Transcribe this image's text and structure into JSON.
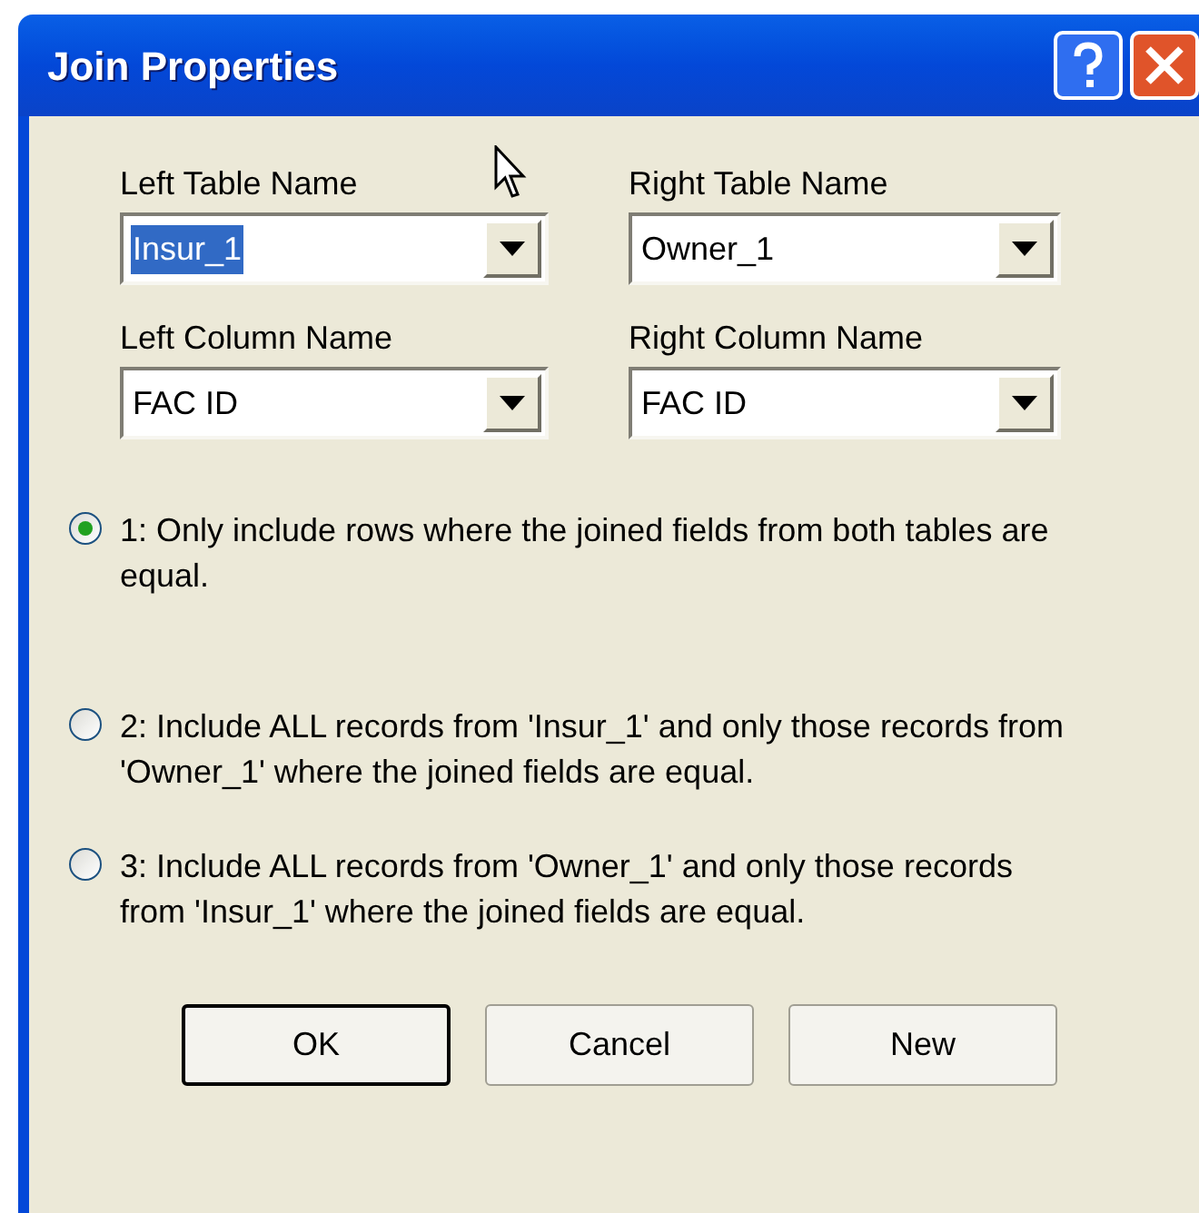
{
  "window": {
    "title": "Join Properties"
  },
  "fields": [
    {
      "label": "Left Table Name",
      "value": "Insur_1",
      "text_selected": true
    },
    {
      "label": "Right Table Name",
      "value": "Owner_1",
      "text_selected": false
    },
    {
      "label": "Left Column Name",
      "value": "FAC ID",
      "text_selected": false
    },
    {
      "label": "Right Column Name",
      "value": "FAC ID",
      "text_selected": false
    }
  ],
  "options": [
    {
      "text": "1: Only include rows where the joined fields from both tables are equal.",
      "selected": true
    },
    {
      "text": "2: Include ALL records from 'Insur_1' and only those records from 'Owner_1' where the joined fields are equal.",
      "selected": false
    },
    {
      "text": "3: Include ALL records from 'Owner_1' and only those records from 'Insur_1' where the joined fields are equal.",
      "selected": false
    }
  ],
  "buttons": [
    {
      "label": "OK",
      "default": true
    },
    {
      "label": "Cancel",
      "default": false
    },
    {
      "label": "New",
      "default": false
    }
  ]
}
